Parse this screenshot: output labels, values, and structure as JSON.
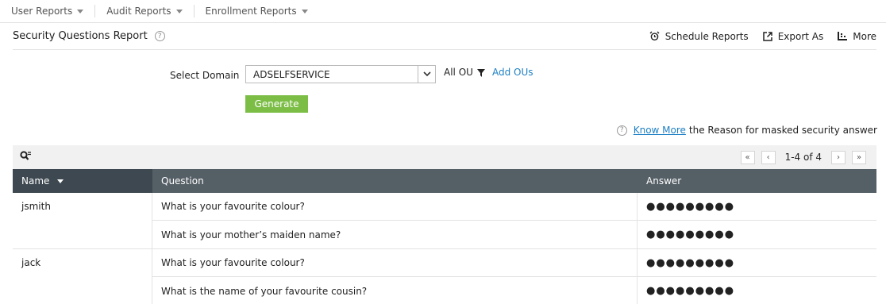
{
  "nav": [
    {
      "label": "User Reports"
    },
    {
      "label": "Audit Reports"
    },
    {
      "label": "Enrollment Reports"
    }
  ],
  "header": {
    "title": "Security Questions Report",
    "help_icon": "?",
    "actions": {
      "schedule": "Schedule Reports",
      "export": "Export As",
      "more": "More"
    }
  },
  "form": {
    "domain_label": "Select Domain",
    "domain_value": "ADSELFSERVICE",
    "ou_label": "All OU",
    "add_ous": "Add OUs",
    "generate": "Generate"
  },
  "info": {
    "link": "Know More",
    "text": "the Reason for masked security answer"
  },
  "pager": {
    "first": "«",
    "prev": "‹",
    "range": "1-4 of 4",
    "next": "›",
    "last": "»"
  },
  "table": {
    "columns": {
      "name": "Name",
      "question": "Question",
      "answer": "Answer"
    },
    "groups": [
      {
        "name": "jsmith",
        "rows": [
          {
            "question": "What is your favourite colour?",
            "answer": "●●●●●●●●●"
          },
          {
            "question": "What is your mother’s maiden name?",
            "answer": "●●●●●●●●●"
          }
        ]
      },
      {
        "name": "jack",
        "rows": [
          {
            "question": "What is your favourite colour?",
            "answer": "●●●●●●●●●"
          },
          {
            "question": "What is the name of your favourite cousin?",
            "answer": "●●●●●●●●●"
          }
        ]
      }
    ]
  }
}
